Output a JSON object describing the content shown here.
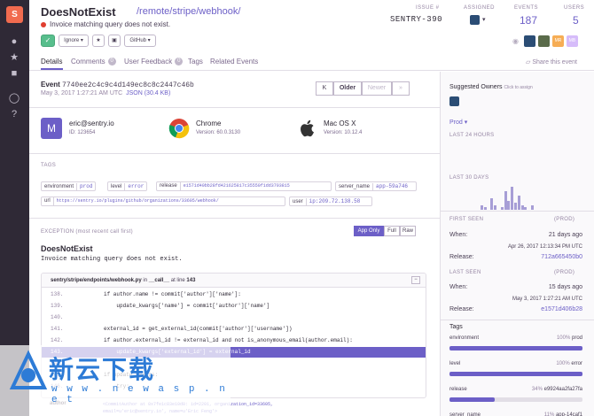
{
  "sidebar": {
    "org_letter": "S"
  },
  "header": {
    "title": "DoesNotExist",
    "path": "/remote/stripe/webhook/",
    "message": "Invoice matching query does not exist.",
    "issue_label": "ISSUE #",
    "issue_id": "SENTRY-390",
    "assigned_label": "ASSIGNED",
    "events_label": "EVENTS",
    "events_value": "187",
    "users_label": "USERS",
    "users_value": "5",
    "avatars": [
      "MR",
      "MB"
    ]
  },
  "actions": {
    "resolve_icon": "check-icon",
    "ignore_label": "Ignore",
    "bookmark_icon": "star-icon",
    "delete_icon": "trash-icon",
    "github_label": "GitHub"
  },
  "tabs": [
    {
      "label": "Details"
    },
    {
      "label": "Comments",
      "count": "0"
    },
    {
      "label": "User Feedback",
      "count": "0"
    },
    {
      "label": "Tags"
    },
    {
      "label": "Related Events"
    }
  ],
  "share_label": "Share this event",
  "event": {
    "label": "Event",
    "id": "7740ee2c4c9c4d149ec8c8c2447c46b",
    "date": "May 3, 2017 1:27:21 AM UTC",
    "json_link": "JSON (30.4 KB)",
    "pager": {
      "first": "K",
      "older": "Older",
      "newer": "Newer",
      "last": "»"
    }
  },
  "context": {
    "user": {
      "initial": "M",
      "name": "eric@sentry.io",
      "sub": "ID: 123654"
    },
    "browser": {
      "name": "Chrome",
      "sub": "Version: 60.0.3130"
    },
    "os": {
      "name": "Mac OS X",
      "sub": "Version: 10.12.4"
    }
  },
  "tags_heading": "TAGS",
  "tags": [
    {
      "key": "environment",
      "value": "prod"
    },
    {
      "key": "level",
      "value": "error"
    },
    {
      "key": "release",
      "value": "e1571d40bb28fd421625817c35550f1dd3703815"
    },
    {
      "key": "server_name",
      "value": "app-59a746"
    },
    {
      "key": "url",
      "value": "https://sentry.io/plugins/github/organizations/33605/webhook/"
    },
    {
      "key": "user",
      "value": "ip:209.72.138.58"
    }
  ],
  "exception": {
    "heading": "EXCEPTION",
    "heading_note": "(most recent call first)",
    "toggles": [
      "App Only",
      "Full",
      "Raw"
    ],
    "type": "DoesNotExist",
    "message": "Invoice matching query does not exist.",
    "frame": {
      "file": "sentry/stripe/endpoints/webhook.py",
      "fn_prefix": "in",
      "fn": "__call__",
      "line_prefix": "at line",
      "line": "143"
    },
    "lines": [
      {
        "n": "138.",
        "code": "if author.name != commit['author']['name']:"
      },
      {
        "n": "139.",
        "code": "    update_kwargs['name'] = commit['author']['name']"
      },
      {
        "n": "140.",
        "code": ""
      },
      {
        "n": "141.",
        "code": "external_id = get_external_id(commit['author']['username'])"
      },
      {
        "n": "142.",
        "code": "if author.external_id != external_id and not is_anonymous_email(author.email):"
      },
      {
        "n": "143.",
        "code": "    update_kwargs['external_id'] = external_id"
      },
      {
        "n": "144.",
        "code": ""
      },
      {
        "n": "145.",
        "code": "if update_kwargs:"
      },
      {
        "n": "146.",
        "code": "    try:"
      }
    ],
    "var_key": "author",
    "var_value": "<CommitAuthor at 0x7fe1c83e10d0: id=2201, organization_id=33605, email=u'eric@sentry.io', name=u'Eric Feng'>"
  },
  "right": {
    "owners_heading": "Suggested Owners",
    "owners_note": "Click to assign",
    "env_label": "Prod",
    "last24": "LAST 24 HOURS",
    "last30": "LAST 30 DAYS",
    "spark_values": [
      2,
      1,
      0,
      5,
      2,
      0,
      1,
      8,
      4,
      10,
      3,
      6,
      2,
      1,
      0,
      2
    ],
    "first_seen": {
      "heading": "FIRST SEEN",
      "env": "(PROD)",
      "when_label": "When:",
      "when_value": "21 days ago",
      "date": "Apr 26, 2017 12:13:34 PM UTC",
      "release_label": "Release:",
      "release_value": "712a665450b0"
    },
    "last_seen": {
      "heading": "LAST SEEN",
      "env": "(PROD)",
      "when_label": "When:",
      "when_value": "15 days ago",
      "date": "May 3, 2017 1:27:21 AM UTC",
      "release_label": "Release:",
      "release_value": "e1571d406b28"
    },
    "tags_heading": "Tags",
    "tag_bars": [
      {
        "key": "environment",
        "pct_label": "100%",
        "value": "prod",
        "pct": 100
      },
      {
        "key": "level",
        "pct_label": "100%",
        "value": "error",
        "pct": 100
      },
      {
        "key": "release",
        "pct_label": "34%",
        "value": "e9924aa2fa27fa",
        "pct": 34
      },
      {
        "key": "server_name",
        "pct_label": "11%",
        "value": "app-14caf1",
        "pct": 11
      }
    ]
  },
  "watermark": {
    "text": "新云下载",
    "url": "w w w . n e w a s p . n e t"
  }
}
